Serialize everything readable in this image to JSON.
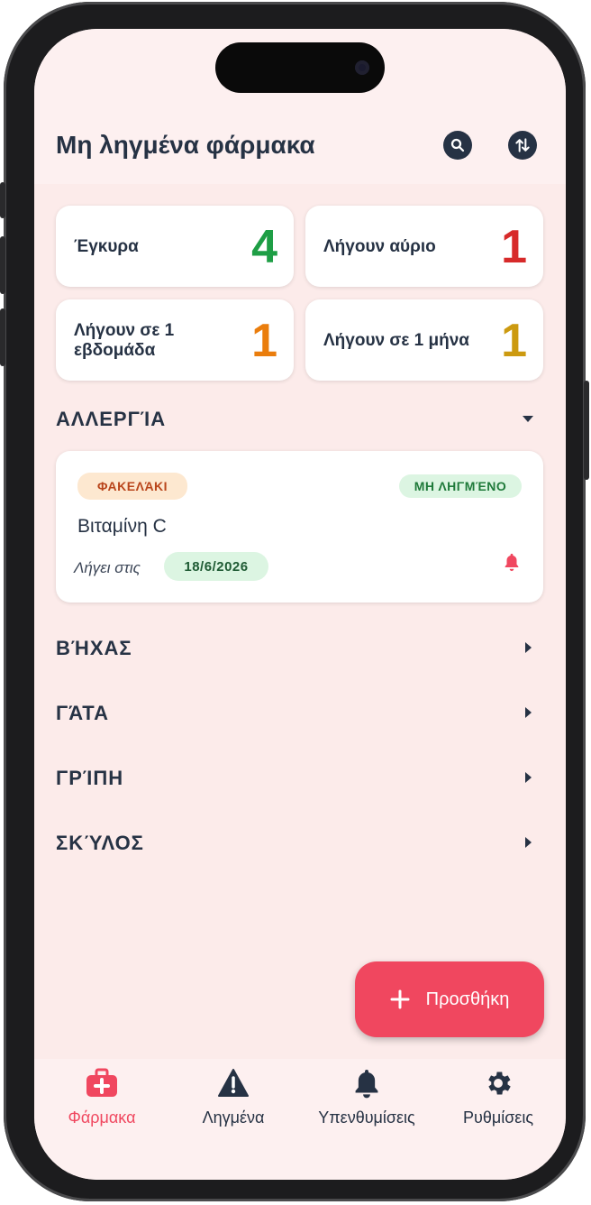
{
  "header": {
    "title": "Μη ληγμένα φάρμακα",
    "search_icon": "search-icon",
    "sort_icon": "sort-arrows-icon"
  },
  "stats": [
    {
      "label": "Έγκυρα",
      "value": "4",
      "color": "#1e9e45"
    },
    {
      "label": "Λήγουν αύριο",
      "value": "1",
      "color": "#d72a2a"
    },
    {
      "label": "Λήγουν σε 1 εβδομάδα",
      "value": "1",
      "color": "#ea7d0c"
    },
    {
      "label": "Λήγουν σε 1 μήνα",
      "value": "1",
      "color": "#cc9a10"
    }
  ],
  "groups": [
    {
      "name": "ΑΛΛΕΡΓΊΑ",
      "expanded": true,
      "items": [
        {
          "type_badge": "ΦΑΚΕΛΆΚΙ",
          "status_badge": "ΜΗ ΛΗΓΜΈΝΟ",
          "name": "Βιταμίνη C",
          "expires_label": "Λήγει στις",
          "expires_date": "18/6/2026"
        }
      ]
    },
    {
      "name": "ΒΉΧΑΣ",
      "expanded": false
    },
    {
      "name": "ΓΆΤΑ",
      "expanded": false
    },
    {
      "name": "ΓΡΊΠΗ",
      "expanded": false
    },
    {
      "name": "ΣΚΎΛΟΣ",
      "expanded": false
    }
  ],
  "fab": {
    "label": "Προσθήκη"
  },
  "tabs": [
    {
      "label": "Φάρμακα",
      "icon": "medical-kit-icon",
      "active": true
    },
    {
      "label": "Ληγμένα",
      "icon": "warning-icon",
      "active": false
    },
    {
      "label": "Υπενθυμίσεις",
      "icon": "bell-icon",
      "active": false
    },
    {
      "label": "Ρυθμίσεις",
      "icon": "gear-icon",
      "active": false
    }
  ],
  "colors": {
    "accent": "#f0475f",
    "text": "#263244",
    "background": "#fcebea",
    "type_badge_bg": "#fde8d0",
    "type_badge_text": "#b9451b",
    "status_badge_bg": "#dcf5e2",
    "status_badge_text": "#1f7a3a",
    "date_chip_bg": "#dcf5e2",
    "date_chip_text": "#1f5b34"
  }
}
